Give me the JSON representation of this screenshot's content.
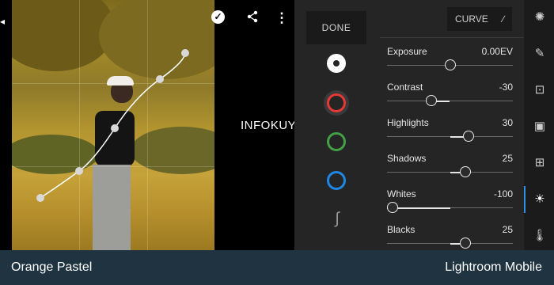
{
  "toolbar": {
    "check_icon": "checkmark-icon",
    "share_icon": "share-icon",
    "more_icon": "more-vertical-icon"
  },
  "watermark": "INFOKUY.NET",
  "tool_panel": {
    "done_label": "DONE",
    "channels": [
      {
        "name": "luminance",
        "color": "#ffffff"
      },
      {
        "name": "red",
        "color": "#e53935"
      },
      {
        "name": "green",
        "color": "#43a047"
      },
      {
        "name": "blue",
        "color": "#1e88e5"
      }
    ]
  },
  "curve_button": {
    "label": "CURVE"
  },
  "adjustments": [
    {
      "label": "Exposure",
      "value": "0.00EV",
      "position": 0.5
    },
    {
      "label": "Contrast",
      "value": "-30",
      "position": 0.35
    },
    {
      "label": "Highlights",
      "value": "30",
      "position": 0.65
    },
    {
      "label": "Shadows",
      "value": "25",
      "position": 0.625
    },
    {
      "label": "Whites",
      "value": "-100",
      "position": 0.0
    },
    {
      "label": "Blacks",
      "value": "25",
      "position": 0.625
    }
  ],
  "side_icons": [
    "presets-icon",
    "healing-icon",
    "crop-icon",
    "layers-icon",
    "selective-icon",
    "light-icon",
    "color-temperature-icon"
  ],
  "bottom_bar": {
    "left_text": "Orange Pastel",
    "right_text": "Lightroom Mobile"
  },
  "colors": {
    "accent": "#2f8fe6",
    "panel": "#252525",
    "bottom_bar": "#1f3340"
  }
}
